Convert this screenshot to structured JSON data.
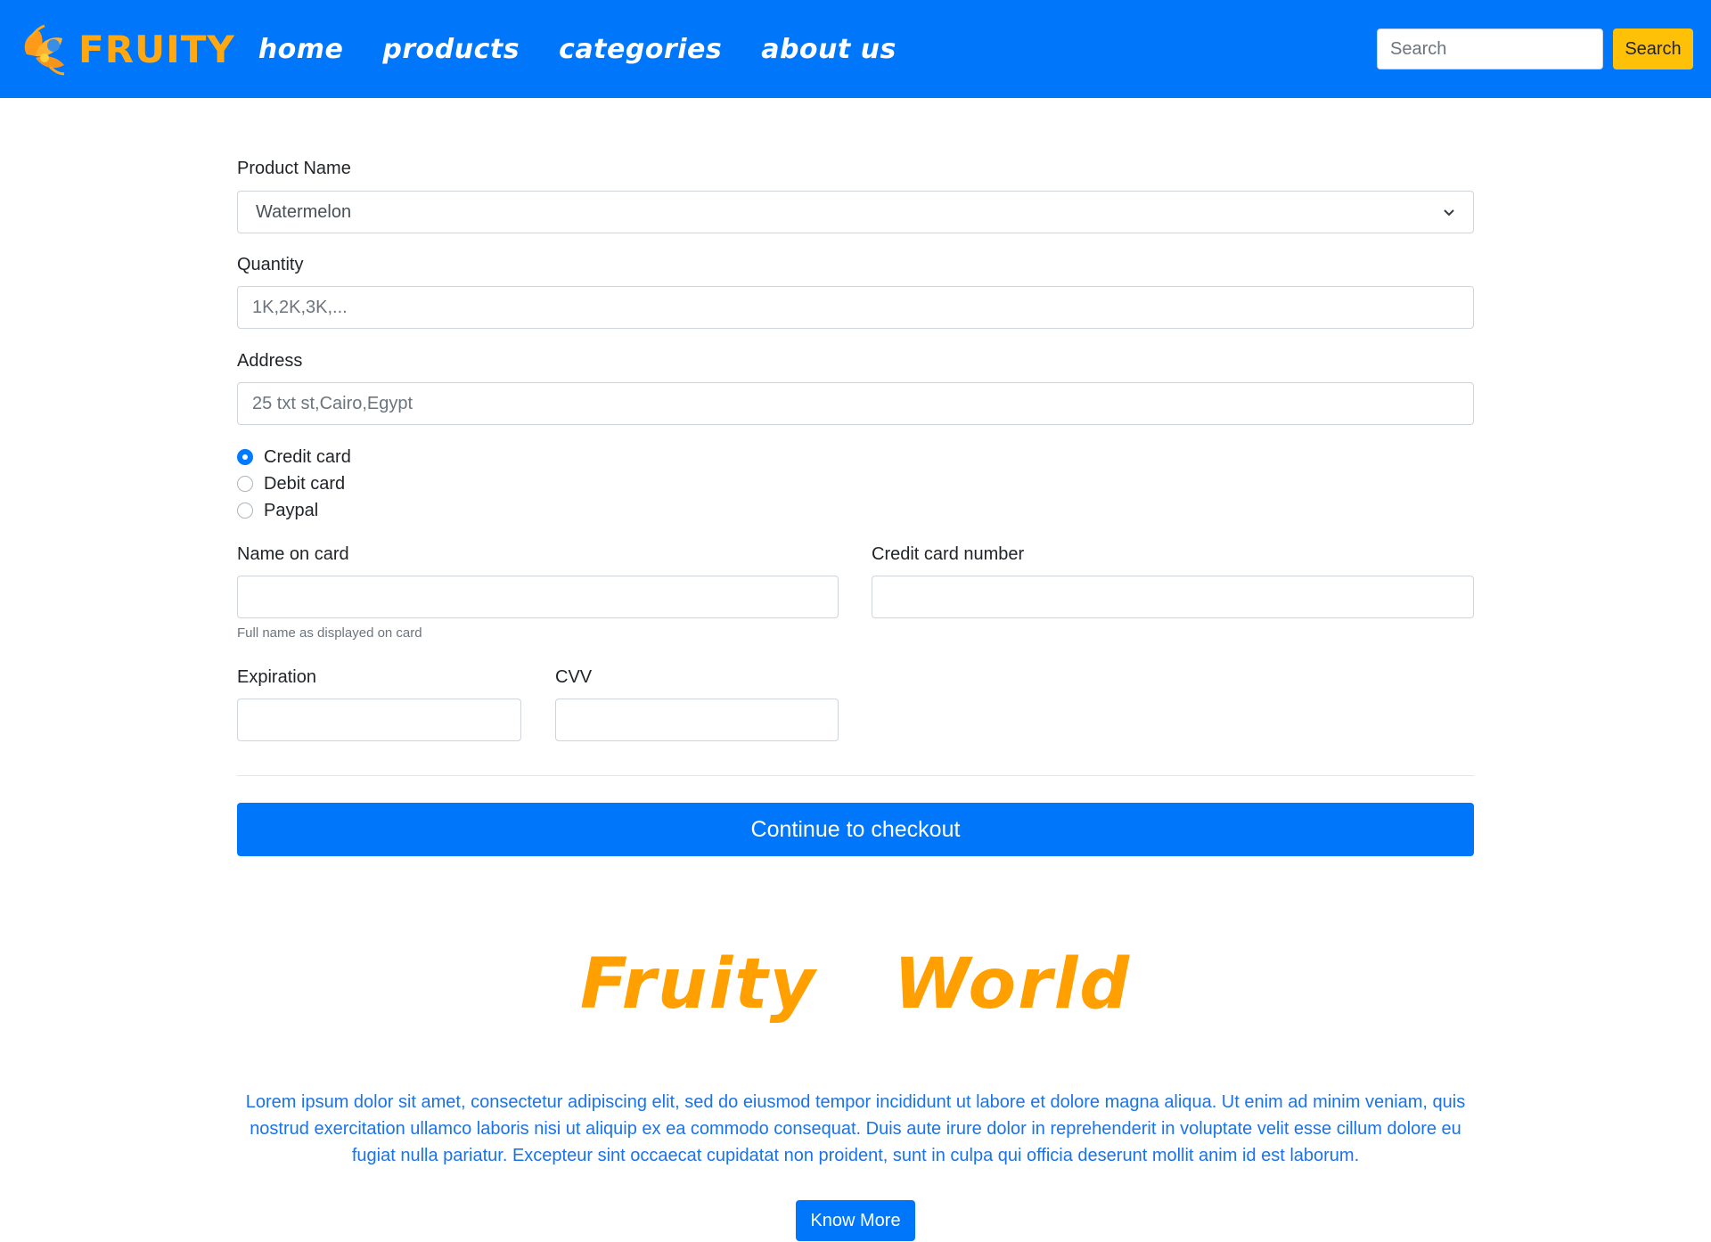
{
  "nav": {
    "brand": "FRUITY",
    "links": [
      "home",
      "products",
      "categories",
      "about us"
    ],
    "search_placeholder": "Search",
    "search_button": "Search"
  },
  "form": {
    "product_label": "Product Name",
    "product_value": "Watermelon",
    "quantity_label": "Quantity",
    "quantity_placeholder": "1K,2K,3K,...",
    "address_label": "Address",
    "address_placeholder": "25 txt st,Cairo,Egypt",
    "payment_options": [
      {
        "label": "Credit card",
        "checked": true
      },
      {
        "label": "Debit card",
        "checked": false
      },
      {
        "label": "Paypal",
        "checked": false
      }
    ],
    "name_on_card_label": "Name on card",
    "name_on_card_help": "Full name as displayed on card",
    "card_number_label": "Credit card number",
    "expiration_label": "Expiration",
    "cvv_label": "CVV",
    "checkout_button": "Continue to checkout"
  },
  "about": {
    "title": "Fruity  World",
    "text": "Lorem ipsum dolor sit amet, consectetur adipiscing elit, sed do eiusmod tempor incididunt ut labore et dolore magna aliqua. Ut enim ad minim veniam, quis nostrud exercitation ullamco laboris nisi ut aliquip ex ea commodo consequat. Duis aute irure dolor in reprehenderit in voluptate velit esse cillum dolore eu fugiat nulla pariatur. Excepteur sint occaecat cupidatat non proident, sunt in culpa qui officia deserunt mollit anim id est laborum.",
    "button": "Know More"
  },
  "colors": {
    "navbar": "#0077fb",
    "brand": "#ffa812",
    "search_button": "#ffc107",
    "title": "#ffa000",
    "lorem": "#1a73e8"
  },
  "icons": [
    "fruit-logo-icon",
    "chevron-down-icon"
  ]
}
